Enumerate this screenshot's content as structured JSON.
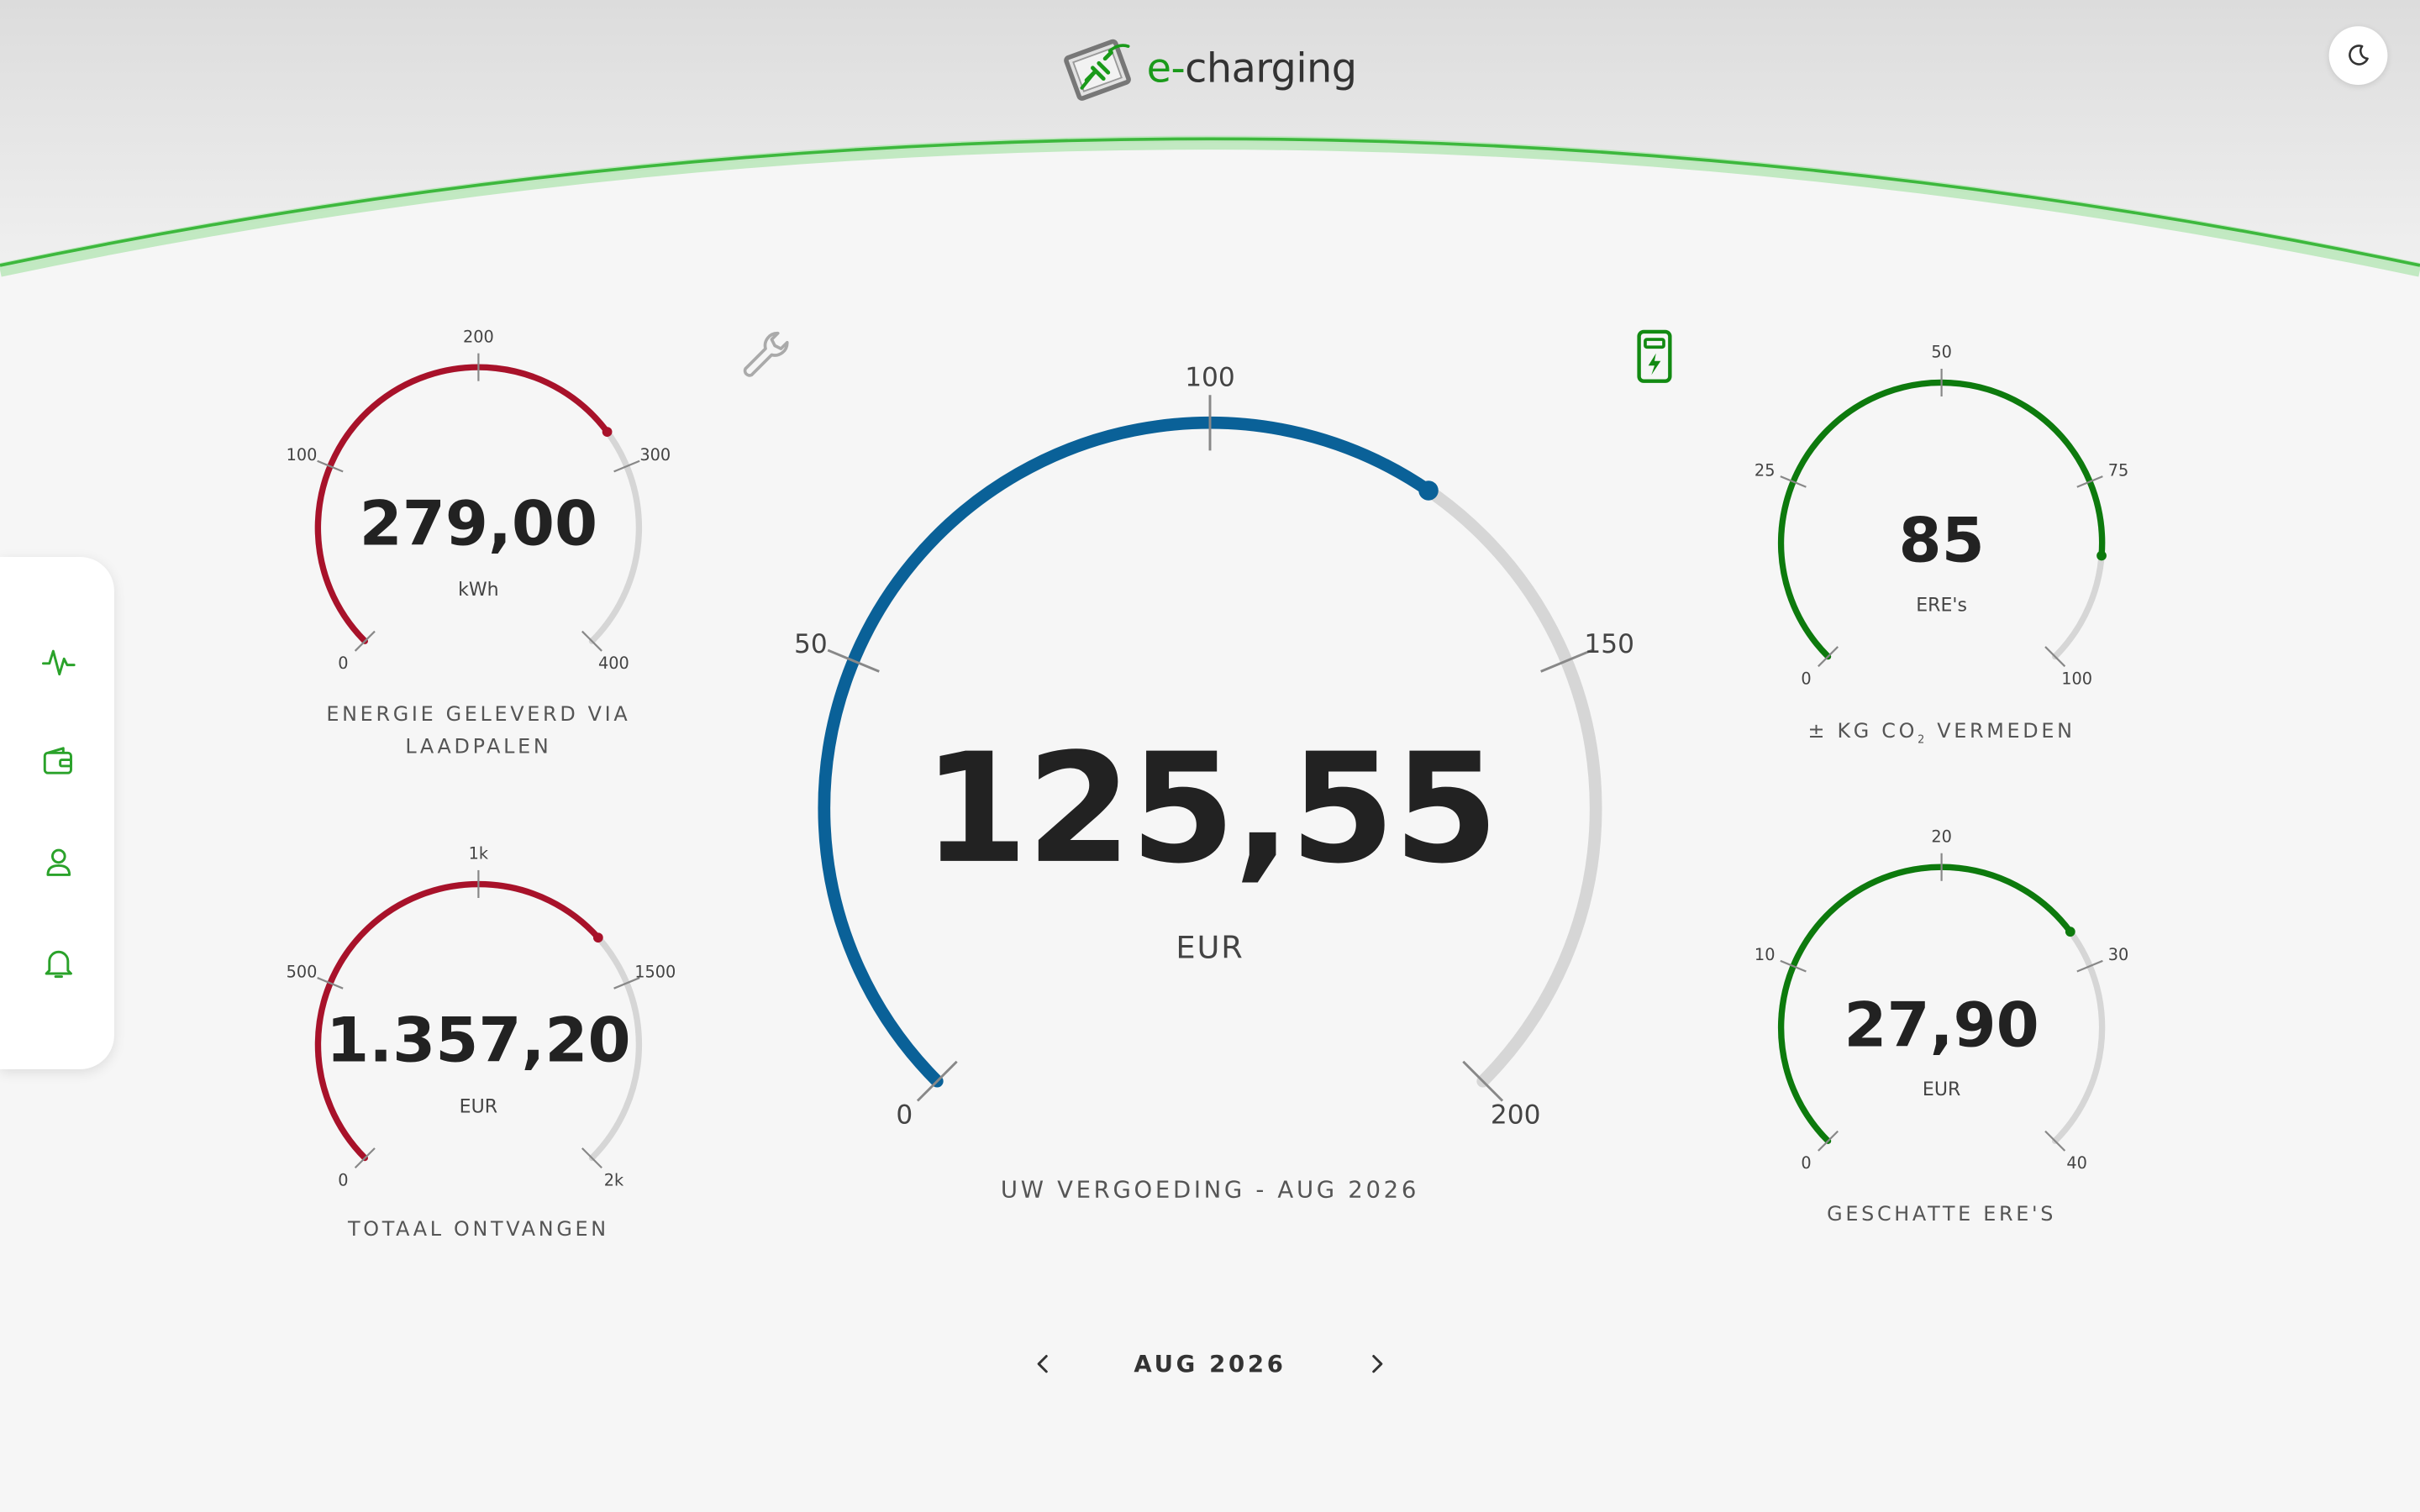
{
  "app": {
    "brand_prefix": "e-",
    "brand_name": "charging",
    "icons": {
      "logo": "charger-plug-logo-icon",
      "theme": "moon-icon"
    }
  },
  "sidebar": {
    "items": [
      {
        "icon": "activity-icon"
      },
      {
        "icon": "wallet-icon"
      },
      {
        "icon": "user-icon"
      },
      {
        "icon": "bell-icon"
      }
    ]
  },
  "toolbar": {
    "settings_icon": "wrench-icon",
    "charger_icon": "charging-station-icon"
  },
  "colors": {
    "red": "#a8122a",
    "green": "#0d7a0d",
    "blue": "#0a6198",
    "track": "#d6d6d6",
    "brand_green": "#1a9a1a"
  },
  "gauges": {
    "energy": {
      "value_text": "279,00",
      "unit": "kWh",
      "value": 279,
      "min": 0,
      "max": 400,
      "tick_labels": [
        "0",
        "100",
        "200",
        "300",
        "400"
      ],
      "caption_line1": "ENERGIE GELEVERD VIA",
      "caption_line2": "LAADPALEN"
    },
    "total": {
      "value_text": "1.357,20",
      "unit": "EUR",
      "value": 1357.2,
      "min": 0,
      "max": 2000,
      "tick_labels": [
        "0",
        "500",
        "1k",
        "1500",
        "2k"
      ],
      "caption": "TOTAAL ONTVANGEN"
    },
    "main": {
      "value_text": "125,55",
      "unit": "EUR",
      "value": 125.55,
      "min": 0,
      "max": 200,
      "tick_labels": [
        "0",
        "50",
        "100",
        "150",
        "200"
      ],
      "caption": "UW VERGOEDING - AUG 2026"
    },
    "co2": {
      "value_text": "85",
      "unit": "ERE's",
      "value": 85,
      "min": 0,
      "max": 100,
      "tick_labels": [
        "0",
        "25",
        "50",
        "75",
        "100"
      ],
      "caption_pre": "± KG CO",
      "caption_sub": "2",
      "caption_post": " VERMEDEN"
    },
    "ere": {
      "value_text": "27,90",
      "unit": "EUR",
      "value": 27.9,
      "min": 0,
      "max": 40,
      "tick_labels": [
        "0",
        "10",
        "20",
        "30",
        "40"
      ],
      "caption": "GESCHATTE ERE'S"
    }
  },
  "period": {
    "label": "AUG 2026",
    "prev_icon": "chevron-left-icon",
    "next_icon": "chevron-right-icon"
  }
}
